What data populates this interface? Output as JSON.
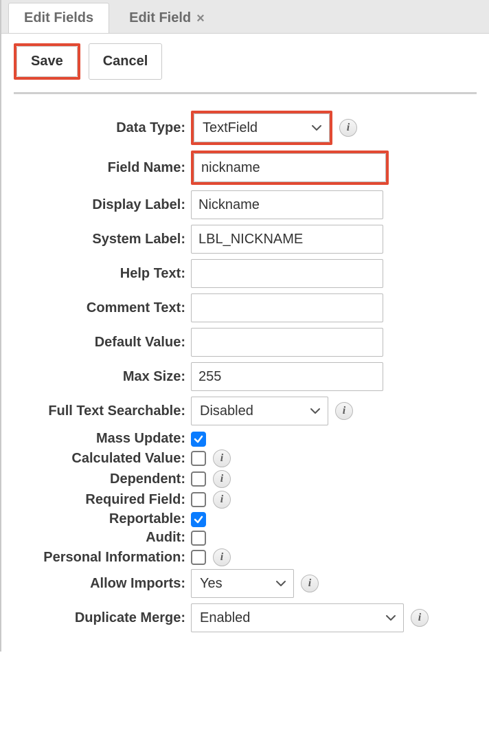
{
  "tabs": {
    "edit_fields": "Edit Fields",
    "edit_field": "Edit Field"
  },
  "toolbar": {
    "save": "Save",
    "cancel": "Cancel"
  },
  "form": {
    "data_type": {
      "label": "Data Type:",
      "value": "TextField"
    },
    "field_name": {
      "label": "Field Name:",
      "value": "nickname"
    },
    "display_label": {
      "label": "Display Label:",
      "value": "Nickname"
    },
    "system_label": {
      "label": "System Label:",
      "value": "LBL_NICKNAME"
    },
    "help_text": {
      "label": "Help Text:",
      "value": ""
    },
    "comment_text": {
      "label": "Comment Text:",
      "value": ""
    },
    "default_value": {
      "label": "Default Value:",
      "value": ""
    },
    "max_size": {
      "label": "Max Size:",
      "value": "255"
    },
    "full_text": {
      "label": "Full Text Searchable:",
      "value": "Disabled"
    },
    "mass_update": {
      "label": "Mass Update:",
      "checked": true
    },
    "calculated_value": {
      "label": "Calculated Value:",
      "checked": false
    },
    "dependent": {
      "label": "Dependent:",
      "checked": false
    },
    "required_field": {
      "label": "Required Field:",
      "checked": false
    },
    "reportable": {
      "label": "Reportable:",
      "checked": true
    },
    "audit": {
      "label": "Audit:",
      "checked": false
    },
    "personal_info": {
      "label": "Personal Information:",
      "checked": false
    },
    "allow_imports": {
      "label": "Allow Imports:",
      "value": "Yes"
    },
    "duplicate_merge": {
      "label": "Duplicate Merge:",
      "value": "Enabled"
    }
  }
}
